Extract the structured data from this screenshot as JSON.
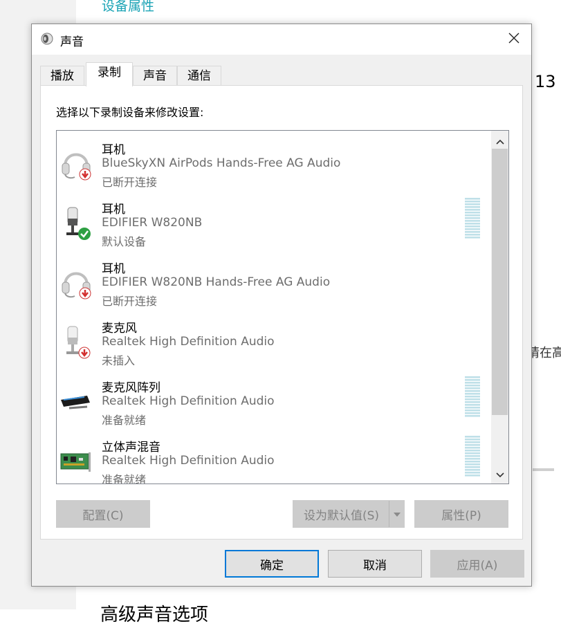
{
  "background": {
    "link_text": "设备属性",
    "number_text": "13",
    "side_text": "请在高",
    "heading_text": "高级声音选项"
  },
  "dialog": {
    "title": "声音",
    "icon": "speaker-icon",
    "close_icon": "close-icon",
    "tabs": [
      {
        "label": "播放",
        "active": false
      },
      {
        "label": "录制",
        "active": true
      },
      {
        "label": "声音",
        "active": false
      },
      {
        "label": "通信",
        "active": false
      }
    ],
    "instruction": "选择以下录制设备来修改设置:",
    "devices": [
      {
        "name": "耳机",
        "description": "BlueSkyXN AirPods Hands-Free AG Audio",
        "status": "已断开连接",
        "icon": "headset-icon",
        "badge": "disconnected-arrow-icon",
        "level_meter": false
      },
      {
        "name": "耳机",
        "description": "EDIFIER W820NB",
        "status": "默认设备",
        "icon": "microphone-icon",
        "badge": "default-check-icon",
        "level_meter": true
      },
      {
        "name": "耳机",
        "description": "EDIFIER W820NB Hands-Free AG Audio",
        "status": "已断开连接",
        "icon": "headset-icon",
        "badge": "disconnected-arrow-icon",
        "level_meter": false
      },
      {
        "name": "麦克风",
        "description": "Realtek High Definition Audio",
        "status": "未插入",
        "icon": "microphone-icon",
        "badge": "unplugged-arrow-icon",
        "level_meter": false
      },
      {
        "name": "麦克风阵列",
        "description": "Realtek High Definition Audio",
        "status": "准备就绪",
        "icon": "microphone-array-icon",
        "badge": null,
        "level_meter": true
      },
      {
        "name": "立体声混音",
        "description": "Realtek High Definition Audio",
        "status": "准备就绪",
        "icon": "sound-card-icon",
        "badge": null,
        "level_meter": true
      }
    ],
    "buttons": {
      "configure": "配置(C)",
      "set_default": "设为默认值(S)",
      "properties": "属性(P)",
      "ok": "确定",
      "cancel": "取消",
      "apply": "应用(A)"
    },
    "colors": {
      "accent": "#0078d7",
      "meter": "#bfe0e8",
      "link": "#1aa3b5",
      "success": "#2ea043",
      "danger": "#d32f2f"
    }
  }
}
